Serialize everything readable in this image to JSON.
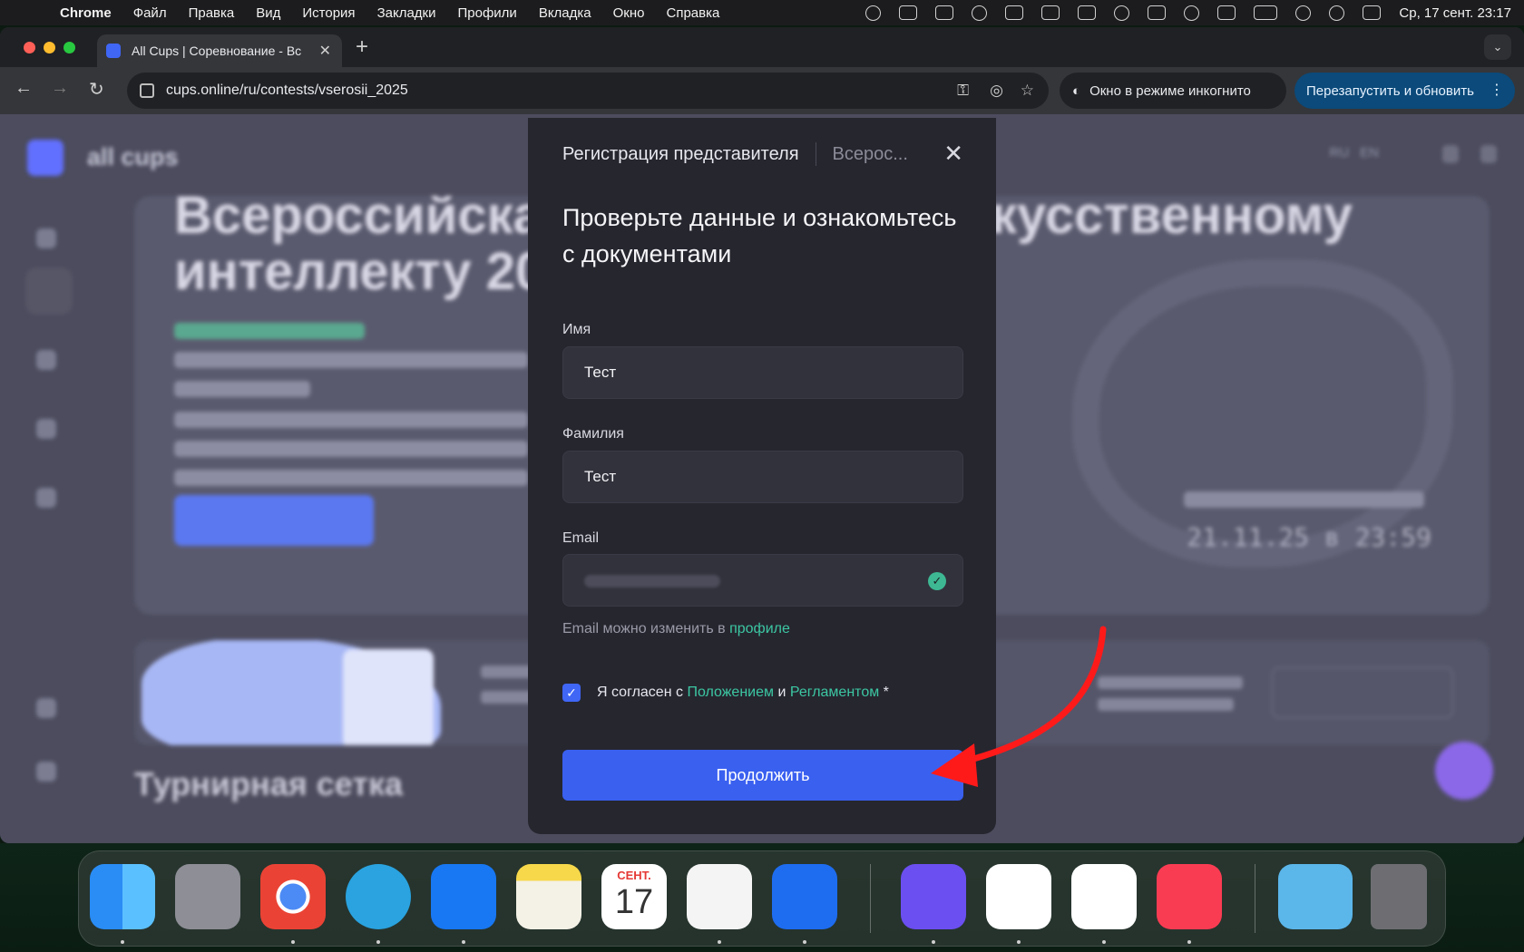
{
  "menubar": {
    "app": "Chrome",
    "items": [
      "Файл",
      "Правка",
      "Вид",
      "История",
      "Закладки",
      "Профили",
      "Вкладка",
      "Окно",
      "Справка"
    ],
    "datetime": "Ср, 17 сент.  23:17"
  },
  "browser": {
    "tab_title": "All Cups | Соревнование - Вс",
    "url": "cups.online/ru/contests/vserosii_2025",
    "incognito_label": "Окно в режиме инкогнито",
    "relaunch_label": "Перезапустить и обновить"
  },
  "page": {
    "logo_text": "all cups",
    "lang_ru": "RU",
    "lang_en": "EN",
    "hero_title_line1": "Всероссийска",
    "hero_title_line1_right": "кусственному",
    "hero_title_line2": "интеллекту 20",
    "countdown": "21.11.25 в 23:59",
    "bracket_title": "Турнирная сетка"
  },
  "modal": {
    "header_title": "Регистрация представителя",
    "header_subtitle": "Всерос...",
    "title": "Проверьте данные и ознакомьтесь с документами",
    "first_name_label": "Имя",
    "first_name_value": "Тест",
    "last_name_label": "Фамилия",
    "last_name_value": "Тест",
    "email_label": "Email",
    "email_hint_prefix": "Email можно изменить в",
    "email_hint_link": "профиле",
    "agree_prefix": "Я согласен с",
    "agree_link1": "Положением",
    "agree_and": "и",
    "agree_link2": "Регламентом",
    "agree_required": "*",
    "continue_label": "Продолжить"
  },
  "dock": {
    "calendar_month": "СЕНТ.",
    "calendar_day": "17"
  },
  "colors": {
    "accent": "#3a60f0",
    "link": "#3cc7a2",
    "annotation_arrow": "#ff1a1a"
  }
}
